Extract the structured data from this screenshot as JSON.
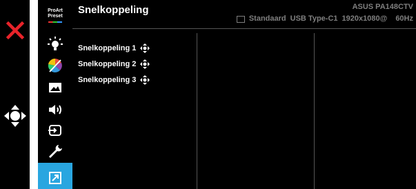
{
  "osd": {
    "menu_title": "Snelkoppeling",
    "model_name": "ASUS PA148CTV",
    "status": {
      "preset": "Standaard",
      "input": "USB Type-C1",
      "resolution": "1920x1080@",
      "refresh": "60Hz"
    },
    "sidebar": {
      "logo_line1": "ProArt",
      "logo_line2": "Preset",
      "items": [
        {
          "icon": "brightness-icon"
        },
        {
          "icon": "color-icon"
        },
        {
          "icon": "image-icon"
        },
        {
          "icon": "sound-icon"
        },
        {
          "icon": "input-select-icon"
        },
        {
          "icon": "system-setup-icon"
        },
        {
          "icon": "shortcut-icon",
          "active": true
        }
      ]
    },
    "shortcuts": [
      {
        "label": "Snelkoppeling 1"
      },
      {
        "label": "Snelkoppeling 2"
      },
      {
        "label": "Snelkoppeling 3"
      }
    ],
    "colors": {
      "accent": "#29a6e0",
      "close": "#e8232a",
      "status_text": "#7f7f7f"
    }
  }
}
